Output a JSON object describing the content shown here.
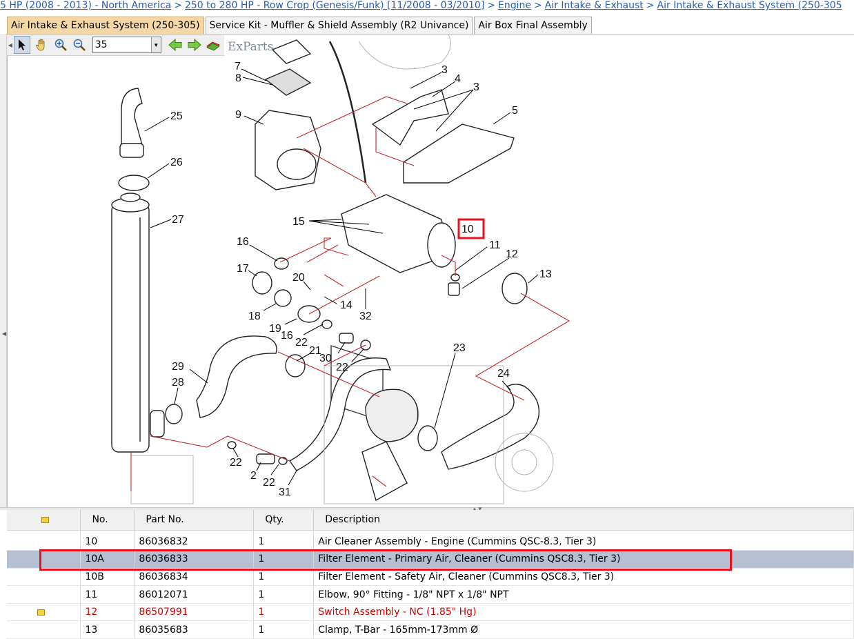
{
  "breadcrumb": [
    "5 HP (2008 - 2013) - North America",
    "250 to 280 HP - Row Crop (Genesis/Funk) [11/2008 - 03/2010]",
    "Engine",
    "Air Intake & Exhaust",
    "Air Intake & Exhaust System (250-305"
  ],
  "tabs": [
    "Air Intake & Exhaust System (250-305)",
    "Service Kit - Muffler & Shield Assembly (R2 Univance)",
    "Air Box Final Assembly"
  ],
  "toolbar": {
    "zoom_value": "35",
    "logo_text": "ExParts"
  },
  "diagram": {
    "callouts": [
      "2",
      "3",
      "3",
      "4",
      "5",
      "7",
      "8",
      "9",
      "10",
      "11",
      "12",
      "13",
      "14",
      "15",
      "16",
      "16",
      "17",
      "18",
      "19",
      "20",
      "21",
      "22",
      "22",
      "22",
      "22",
      "23",
      "24",
      "25",
      "26",
      "27",
      "28",
      "29",
      "30",
      "31",
      "32"
    ],
    "highlight_callout": "10",
    "highlight_color": "#e8121e",
    "line_color": "#c4282c"
  },
  "table": {
    "headers": [
      "No.",
      "Part No.",
      "Qty.",
      "Description"
    ],
    "rows": [
      {
        "no": "10",
        "part": "86036832",
        "qty": "1",
        "desc": "Air Cleaner Assembly - Engine (Cummins QSC-8.3, Tier 3)"
      },
      {
        "no": "10A",
        "part": "86036833",
        "qty": "1",
        "desc": "Filter Element - Primary Air, Cleaner (Cummins QSC8.3, Tier 3)"
      },
      {
        "no": "10B",
        "part": "86036834",
        "qty": "1",
        "desc": "Filter Element - Safety Air, Cleaner (Cummins QSC8.3, Tier 3)"
      },
      {
        "no": "11",
        "part": "86012071",
        "qty": "1",
        "desc": "Elbow, 90° Fitting - 1/8\" NPT x 1/8\" NPT"
      },
      {
        "no": "12",
        "part": "86507991",
        "qty": "1",
        "desc": "Switch Assembly - NC (1.85\" Hg)"
      },
      {
        "no": "13",
        "part": "86035683",
        "qty": "1",
        "desc": "Clamp, T-Bar - 165mm-173mm Ø"
      }
    ],
    "selected_row": "10A",
    "red_row": "12",
    "selected_color": "#b7bfd2",
    "red_color": "#d40000"
  }
}
